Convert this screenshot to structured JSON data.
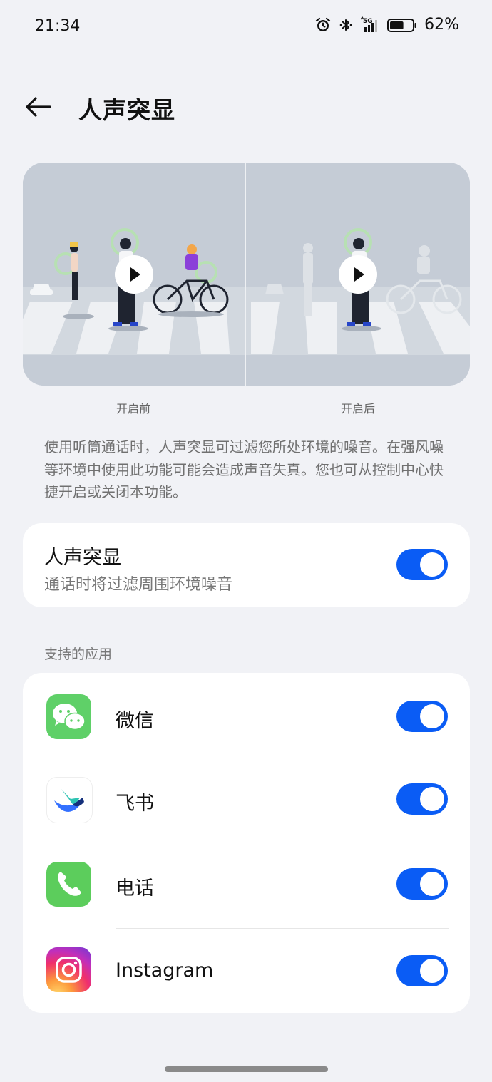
{
  "status_bar": {
    "time": "21:34",
    "battery_percent": "62%",
    "battery_level": 0.62,
    "network": "5G",
    "icons": [
      "alarm-icon",
      "bluetooth-icon",
      "signal-5g-icon",
      "battery-icon"
    ]
  },
  "header": {
    "title": "人声突显"
  },
  "illustration": {
    "before_caption": "开启前",
    "after_caption": "开启后"
  },
  "description": "使用听筒通话时，人声突显可过滤您所处环境的噪音。在强风噪等环境中使用此功能可能会造成声音失真。您也可从控制中心快捷开启或关闭本功能。",
  "main_setting": {
    "title": "人声突显",
    "subtitle": "通话时将过滤周围环境噪音",
    "enabled": true
  },
  "apps_section": {
    "label": "支持的应用",
    "apps": [
      {
        "name": "微信",
        "icon": "wechat-icon",
        "enabled": true
      },
      {
        "name": "飞书",
        "icon": "feishu-icon",
        "enabled": true
      },
      {
        "name": "电话",
        "icon": "phone-icon",
        "enabled": true
      },
      {
        "name": "Instagram",
        "icon": "instagram-icon",
        "enabled": true
      }
    ]
  },
  "colors": {
    "accent": "#0a5cf5",
    "background": "#f1f2f6",
    "card": "#ffffff",
    "wechat_green": "#5fd068",
    "phone_green": "#5ccd5c"
  }
}
